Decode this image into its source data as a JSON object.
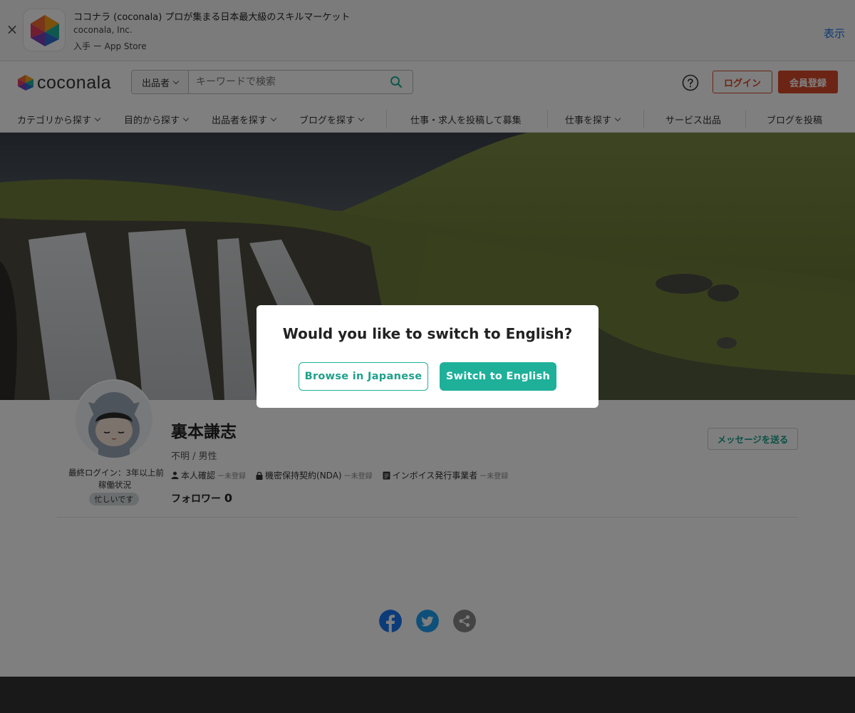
{
  "app_banner": {
    "close": "×",
    "title": "ココナラ (coconala) プロが集まる日本最大級のスキルマーケット",
    "company": "coconala, Inc.",
    "store": "入手 ー App Store",
    "view": "表示"
  },
  "header": {
    "logo_text": "coconala",
    "search_select": "出品者",
    "search_placeholder": "キーワードで検索",
    "login": "ログイン",
    "signup": "会員登録"
  },
  "nav": {
    "items": [
      "カテゴリから探す",
      "目的から探す",
      "出品者を探す",
      "ブログを探す",
      "仕事・求人を投稿して募集",
      "仕事を探す",
      "サービス出品",
      "ブログを投稿"
    ]
  },
  "profile": {
    "last_login": "最終ログイン：3年以上前",
    "status_label": "稼働状況",
    "busy": "忙しいです",
    "name": "裏本謙志",
    "gender": "不明 / 男性",
    "verify": [
      {
        "label": "本人確認",
        "state": "ー未登録"
      },
      {
        "label": "機密保持契約(NDA)",
        "state": "ー未登録"
      },
      {
        "label": "インボイス発行事業者",
        "state": "ー未登録"
      }
    ],
    "followers_label": "フォロワー",
    "followers": "0",
    "message_button": "メッセージを送る"
  },
  "modal": {
    "title": "Would you like to switch to English?",
    "browse_japanese": "Browse in Japanese",
    "switch_english": "Switch to English"
  },
  "colors": {
    "brand_red": "#d94a2b",
    "accent_teal": "#1fb09a",
    "facebook": "#1877f2",
    "twitter": "#1da1f2",
    "share": "#888888"
  }
}
